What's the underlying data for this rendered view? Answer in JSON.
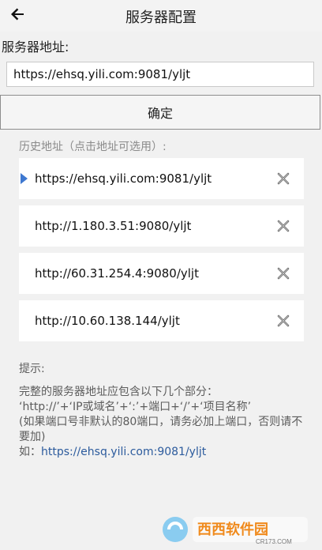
{
  "header": {
    "title": "服务器配置"
  },
  "server": {
    "label": "服务器地址:",
    "value": "https://ehsq.yili.com:9081/yljt"
  },
  "confirm_label": "确定",
  "history": {
    "title": "历史地址（点击地址可选用）:",
    "items": [
      {
        "url": "https://ehsq.yili.com:9081/yljt",
        "selected": true
      },
      {
        "url": "http://1.180.3.51:9080/yljt",
        "selected": false
      },
      {
        "url": "http://60.31.254.4:9080/yljt",
        "selected": false
      },
      {
        "url": "http://10.60.138.144/yljt",
        "selected": false
      }
    ]
  },
  "tips": {
    "label": "提示:",
    "line1": "完整的服务器地址应包含以下几个部分：",
    "line2": "‘http://’+‘IP或域名’+‘:’+端口+‘/’+‘项目名称’",
    "line3": "(如果端口号非默认的80端口，请务必加上端口，否则请不要加)",
    "example_prefix": "如：",
    "example_url": "https://ehsq.yili.com:9081/yljt"
  },
  "watermark": {
    "brand": "西西软件园",
    "site": "CR173.COM"
  },
  "icons": {
    "back": "back-arrow-icon",
    "delete": "delete-x-icon",
    "selected": "selected-triangle-icon"
  },
  "colors": {
    "accent": "#3e78d0",
    "link": "#2c5b9d",
    "watermark_orange": "#f08a1c"
  }
}
